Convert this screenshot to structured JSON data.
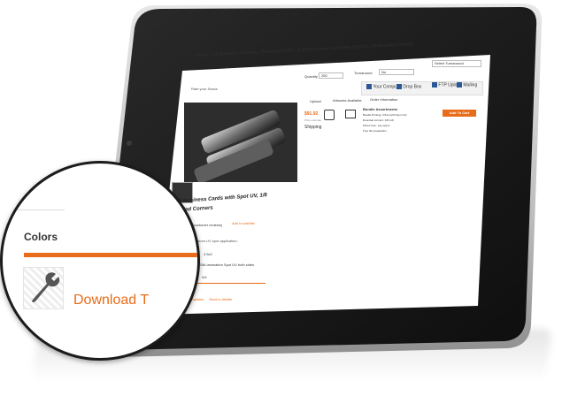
{
  "screen": {
    "breadcrumb": "Home > All Products > Printing > Business Cards > 3.5x2 Business Cards With Spot UV, 1/8 Rounded Corners",
    "quantity_label": "Quantity",
    "quantity_value": "250",
    "turnaround_label": "Turnaround",
    "turnaround_value": "No",
    "delivery_select": "Select Turnaround",
    "rate_link": "Rate your Snack",
    "upload_options": [
      {
        "icon": "computer-icon",
        "label": "Your Computer"
      },
      {
        "icon": "dropbox-icon",
        "label": "Drop Box"
      },
      {
        "icon": "upload-icon",
        "label": "FTP Upload"
      },
      {
        "icon": "mail-icon",
        "label": "Mailing"
      }
    ],
    "tabs": [
      "Upload",
      "Artworks Available",
      "Order Information"
    ],
    "price_value": "$91.92",
    "price_note": "Price estimate",
    "shipping_label": "Shipping",
    "options_title": "Bundle Assortments",
    "options_lines": [
      "Bundle Printing: 3.5x2 (with Spot UV)",
      "Rounded corners: 1/8 inch",
      "Prices from: see specs",
      "Free file preparation"
    ],
    "add_to_cart": "Add To Cart",
    "product_title_1": "3.5x2 Business Cards with Spot UV, 1/8",
    "product_title_2": "Rounded Corners",
    "rating_text": "(2 customer reviews)",
    "wishlist": "Add to wishlist",
    "more_details": "More Details",
    "more_details_text": "16 card stock with custom UV spot application.",
    "specs": [
      {
        "key": "Card Size",
        "value": "3.5x2"
      },
      {
        "key": "Coating",
        "value": "Silk lamination Spot UV both sides"
      },
      {
        "key": "Colors",
        "value": "4/4"
      }
    ],
    "download_templates": "Download templates",
    "send_artwork": "Send in details"
  },
  "magnifier": {
    "section_label": "Colors",
    "download_text": "Download T",
    "icon": "wrench-icon"
  },
  "colors": {
    "accent": "#e86c1a",
    "tablet_frame": "#1c1c1c",
    "bezel_silver": "#c9c9c9"
  }
}
